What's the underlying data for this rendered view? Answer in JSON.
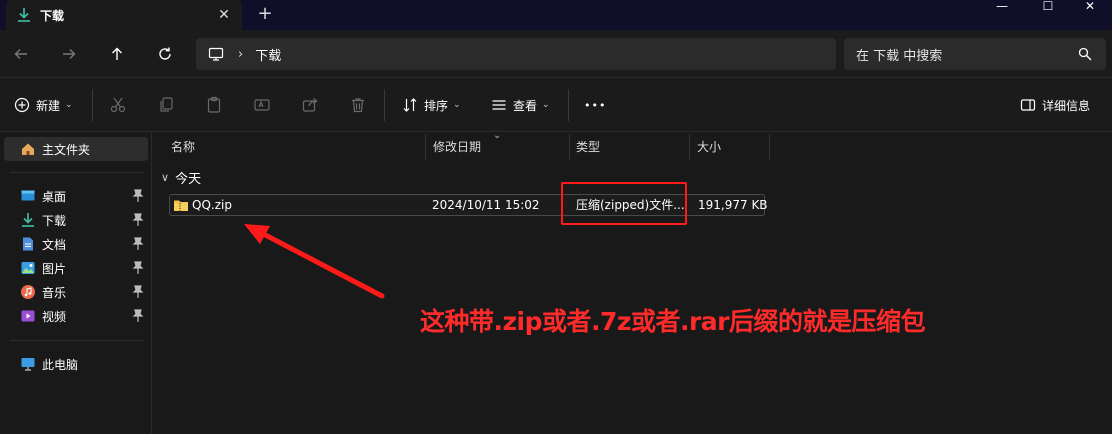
{
  "window": {
    "tab_title": "下载",
    "close_tab": "✕",
    "new_tab": "+",
    "minimize": "—",
    "maximize": "☐",
    "close": "✕"
  },
  "address": {
    "path": "下载",
    "separator": "›",
    "search_placeholder": "在 下载 中搜索"
  },
  "commands": {
    "new_label": "新建",
    "sort_label": "排序",
    "view_label": "查看",
    "more_label": "•••",
    "details_label": "详细信息"
  },
  "sidebar": {
    "home": "主文件夹",
    "items": [
      {
        "label": "桌面",
        "icon": "desktop-icon"
      },
      {
        "label": "下载",
        "icon": "download-icon"
      },
      {
        "label": "文档",
        "icon": "document-icon"
      },
      {
        "label": "图片",
        "icon": "pictures-icon"
      },
      {
        "label": "音乐",
        "icon": "music-icon"
      },
      {
        "label": "视频",
        "icon": "video-icon"
      }
    ],
    "this_pc": "此电脑"
  },
  "columns": {
    "name": "名称",
    "modified": "修改日期",
    "type": "类型",
    "size": "大小"
  },
  "group": {
    "label": "今天"
  },
  "files": [
    {
      "name": "QQ.zip",
      "modified": "2024/10/11 15:02",
      "type": "压缩(zipped)文件...",
      "size": "191,977 KB"
    }
  ],
  "annotation": {
    "text": "这种带.zip或者.7z或者.rar后缀的就是压缩包",
    "color": "#ff2b2b"
  },
  "colors": {
    "background": "#191919",
    "titlebar": "#0f0f2a",
    "download_accent": "#3fc1a5",
    "folder_yellow": "#f3c04a"
  }
}
